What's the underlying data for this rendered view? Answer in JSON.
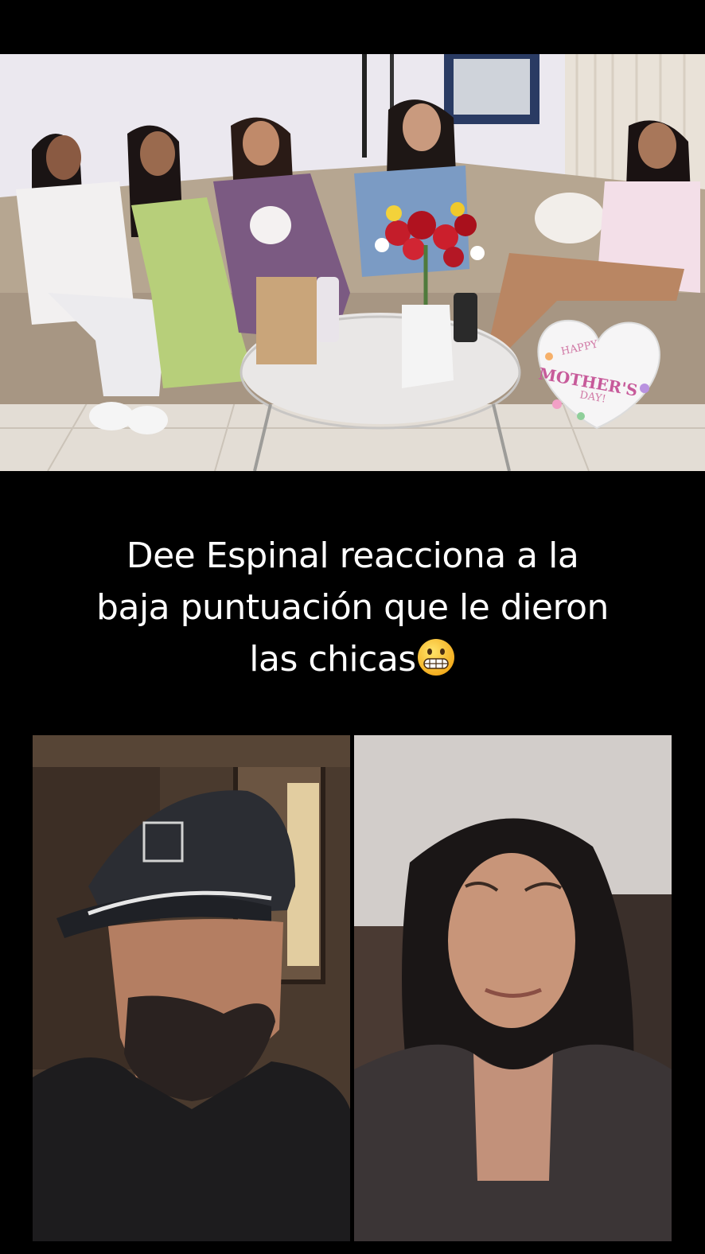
{
  "caption": {
    "line1": "Dee Espinal reacciona a la",
    "line2": "baja puntuación que le dieron",
    "line3": "las chicas"
  },
  "top_video": {
    "balloon_text_1": "HAPPY",
    "balloon_text_2": "MOTHER'S",
    "balloon_text_3": "DAY!"
  },
  "icons": {
    "caption_emoji": "grimacing-face-icon"
  },
  "colors": {
    "background": "#000000",
    "caption_text": "#ffffff"
  }
}
